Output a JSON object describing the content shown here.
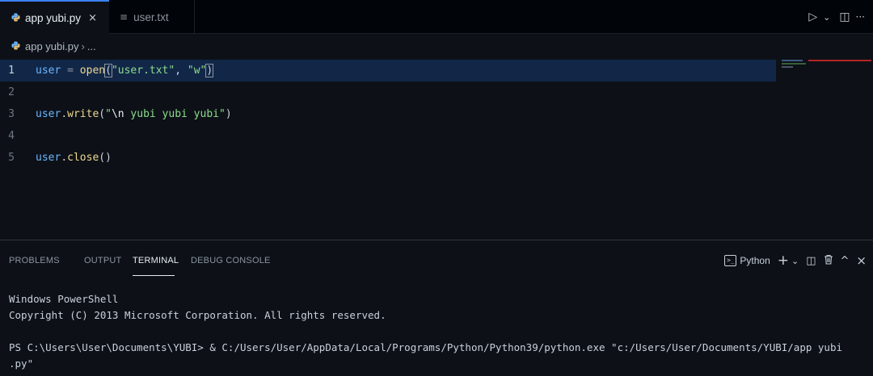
{
  "tabs": [
    {
      "label": "app yubi.py",
      "active": true,
      "icon": "python-icon"
    },
    {
      "label": "user.txt",
      "active": false,
      "icon": "text-file-icon"
    }
  ],
  "tab_actions": {
    "run": "▷",
    "run_menu": "⌄",
    "split": "◫",
    "more": "···"
  },
  "breadcrumb": {
    "file": "app yubi.py",
    "separator": "›",
    "symbol": "..."
  },
  "editor": {
    "line_numbers": [
      "1",
      "2",
      "3",
      "4",
      "5"
    ],
    "line1": {
      "var": "user",
      "op": " = ",
      "fn": "open",
      "lp": "(",
      "s1": "\"user.txt\"",
      "comma": ", ",
      "s2": "\"w\"",
      "rp": ")"
    },
    "line3": {
      "var": "user",
      "dot": ".",
      "fn": "write",
      "lp": "(",
      "q1": "\"",
      "esc": "\\n",
      "str": " yubi yubi yubi",
      "q2": "\"",
      "rp": ")"
    },
    "line5": {
      "var": "user",
      "dot": ".",
      "fn": "close",
      "paren": "()"
    }
  },
  "panel": {
    "tabs": [
      "PROBLEMS",
      "OUTPUT",
      "TERMINAL",
      "DEBUG CONSOLE"
    ],
    "active_tab": "TERMINAL",
    "profile": "Python",
    "terminal_glyph": ">_",
    "actions": {
      "add": "+",
      "add_menu": "⌄",
      "split": "◫",
      "kill": "🗑",
      "maximize": "^",
      "close": "×"
    }
  },
  "terminal": {
    "line1": "Windows PowerShell",
    "line2": "Copyright (C) 2013 Microsoft Corporation. All rights reserved.",
    "line3": "PS C:\\Users\\User\\Documents\\YUBI> & C:/Users/User/AppData/Local/Programs/Python/Python39/python.exe \"c:/Users/User/Documents/YUBI/app yubi",
    "line4": ".py\""
  },
  "colors": {
    "background": "#0d1117",
    "active_line": "#122748",
    "accent": "#3b82f6",
    "string": "#8ddb8c",
    "variable": "#6cb6ff",
    "function": "#f0d890"
  }
}
